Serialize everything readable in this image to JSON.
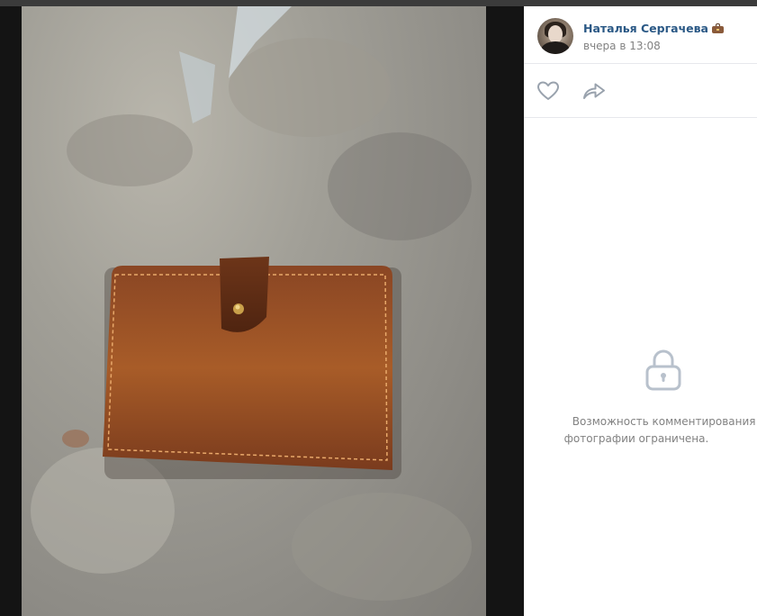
{
  "post": {
    "author_name": "Наталья Сергачева",
    "author_badge_icon": "briefcase-icon",
    "timestamp": "вчера в 13:08"
  },
  "actions": {
    "like_icon": "heart-icon",
    "share_icon": "share-arrow-icon"
  },
  "comments": {
    "lock_icon": "lock-icon",
    "restricted_line1": "Возможность комментирования это",
    "restricted_line2": "фотографии ограничена."
  },
  "colors": {
    "link": "#2a5885",
    "muted": "#828282",
    "icon": "#99a2ad",
    "photo_background": "#141414"
  }
}
